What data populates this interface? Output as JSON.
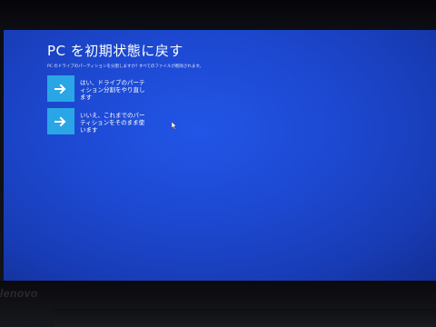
{
  "screen": {
    "title": "PC を初期状態に戻す",
    "subtitle": "PC のドライブのパーティションを分割しますか? すべてのファイルが削除されます。",
    "options": [
      {
        "label": "はい、ドライブのパーティション分割をやり直します",
        "icon": "arrow-right-icon"
      },
      {
        "label": "いいえ、これまでのパーティションをそのまま使います",
        "icon": "arrow-right-icon"
      }
    ]
  },
  "bezel": {
    "brand": "lenovo"
  },
  "colors": {
    "screen_bg": "#1d49d2",
    "tile": "#2aa6e6",
    "text": "#ffffff"
  }
}
